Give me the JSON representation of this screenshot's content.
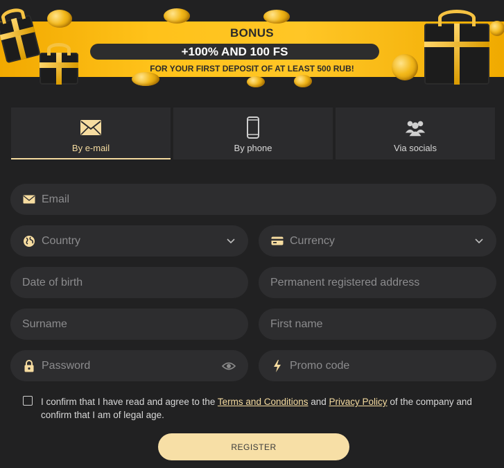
{
  "banner": {
    "title": "BONUS",
    "headline": "+100% AND 100 FS",
    "subtitle": "FOR YOUR FIRST DEPOSIT OF AT LEAST 500 RUB!"
  },
  "tabs": [
    {
      "label": "By e-mail",
      "icon": "envelope-icon",
      "active": true
    },
    {
      "label": "By phone",
      "icon": "phone-icon",
      "active": false
    },
    {
      "label": "Via socials",
      "icon": "people-icon",
      "active": false
    }
  ],
  "form": {
    "email": {
      "placeholder": "Email",
      "icon": "envelope-icon"
    },
    "country": {
      "placeholder": "Country",
      "icon": "globe-icon"
    },
    "currency": {
      "placeholder": "Currency",
      "icon": "card-icon"
    },
    "dob": {
      "placeholder": "Date of birth"
    },
    "address": {
      "placeholder": "Permanent registered address"
    },
    "surname": {
      "placeholder": "Surname"
    },
    "first_name": {
      "placeholder": "First name"
    },
    "password": {
      "placeholder": "Password",
      "icon": "lock-icon",
      "toggle_icon": "eye-icon"
    },
    "promo": {
      "placeholder": "Promo code",
      "icon": "lightning-icon"
    }
  },
  "agreement": {
    "text_1": "I confirm that I have read and agree to the ",
    "terms_link": "Terms and Conditions",
    "text_2": " and ",
    "privacy_link": "Privacy Policy",
    "text_3": " of the company and confirm that I am of legal age."
  },
  "register_label": "REGISTER",
  "colors": {
    "background": "#212122",
    "field": "#2d2d2f",
    "accent": "#f6dca0",
    "banner": "#ffc21a"
  }
}
